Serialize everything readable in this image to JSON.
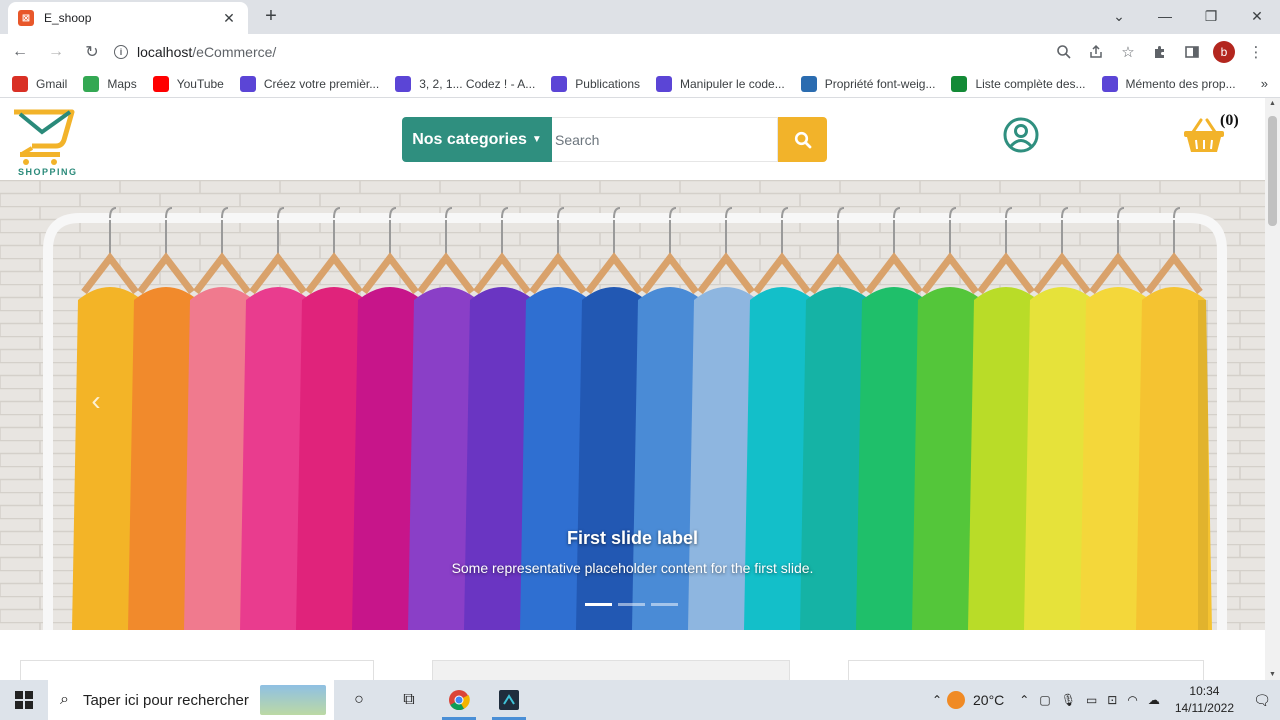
{
  "browser": {
    "tab_title": "E_shoop",
    "url_host": "localhost",
    "url_path": "/eCommerce/",
    "profile_initial": "b",
    "bookmarks": [
      {
        "label": "Gmail",
        "icon": "gmail-icon",
        "color": "#d93025"
      },
      {
        "label": "Maps",
        "icon": "maps-icon",
        "color": "#34a853"
      },
      {
        "label": "YouTube",
        "icon": "youtube-icon",
        "color": "#ff0000"
      },
      {
        "label": "Créez votre premièr...",
        "icon": "openclassrooms-icon",
        "color": "#5b45d6"
      },
      {
        "label": "3, 2, 1... Codez ! - A...",
        "icon": "openclassrooms-icon",
        "color": "#5b45d6"
      },
      {
        "label": "Publications",
        "icon": "publications-icon",
        "color": "#5b45d6"
      },
      {
        "label": "Manipuler le code...",
        "icon": "openclassrooms-icon",
        "color": "#5b45d6"
      },
      {
        "label": "Propriété font-weig...",
        "icon": "css-icon",
        "color": "#2b6cb0"
      },
      {
        "label": "Liste complète des...",
        "icon": "globe-icon",
        "color": "#138a36"
      },
      {
        "label": "Mémento des prop...",
        "icon": "openclassrooms-icon",
        "color": "#5b45d6"
      }
    ],
    "bookmarks_more": "»"
  },
  "site": {
    "logo_text": "SHOPPING",
    "categories_label": "Nos categories",
    "search_placeholder": "Search",
    "cart_count": "(0)",
    "colors": {
      "teal": "#2f8f7f",
      "yellow": "#f2b32a"
    }
  },
  "carousel": {
    "slide_title": "First slide label",
    "slide_text": "Some representative placeholder content for the first slide.",
    "slides_total": 3,
    "active_slide": 1
  },
  "taskbar": {
    "search_placeholder": "Taper ici pour rechercher",
    "temperature": "20°C",
    "time": "10:34",
    "date": "14/11/2022"
  }
}
